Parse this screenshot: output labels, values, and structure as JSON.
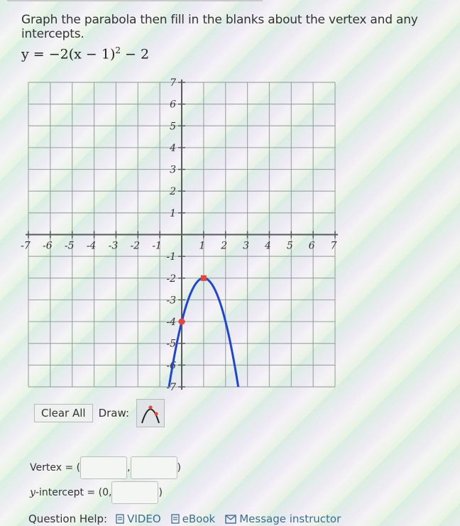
{
  "question": {
    "prompt": "Graph the parabola then fill in the blanks about the vertex and any intercepts.",
    "equation": {
      "prefix": "y = −2(x − 1)",
      "exponent": "2",
      "suffix": " − 2"
    }
  },
  "graph": {
    "x_range": [
      -7,
      7
    ],
    "y_range": [
      -7,
      7
    ],
    "x_tick_labels": [
      "-7",
      "-6",
      "-5",
      "-4",
      "-3",
      "-2",
      "-1",
      "1",
      "2",
      "3",
      "4",
      "5",
      "6",
      "7"
    ],
    "y_tick_labels": [
      "7",
      "6",
      "5",
      "4",
      "3",
      "2",
      "1",
      "-1",
      "-2",
      "-3",
      "-4",
      "-5",
      "-6",
      "-7"
    ],
    "curve": {
      "type": "parabola",
      "a": -2,
      "h": 1,
      "k": -2,
      "color": "#1f45d1"
    },
    "points": [
      {
        "name": "vertex-point",
        "x": 1,
        "y": -2,
        "shape": "square",
        "color": "#e8463a"
      },
      {
        "name": "second-point",
        "x": 0,
        "y": -4,
        "shape": "circle",
        "color": "#e8463a"
      }
    ],
    "grid_color": "#8c9a96",
    "axis_color": "#555a5a"
  },
  "controls": {
    "clear_all": "Clear All",
    "draw_label": "Draw:",
    "draw_tool": "parabola-tool"
  },
  "answers": {
    "vertex_label": "Vertex = (",
    "vertex_comma": ",",
    "vertex_close": ")",
    "vertex_x": "",
    "vertex_y": "",
    "yint_label_var": "y",
    "yint_label_rest": "-intercept = (0,",
    "yint_close": ")",
    "yint_value": ""
  },
  "help": {
    "label": "Question Help:",
    "links": [
      {
        "icon": "document-icon",
        "label": "VIDEO"
      },
      {
        "icon": "document-icon",
        "label": "eBook"
      },
      {
        "icon": "envelope-icon",
        "label": "Message instructor"
      }
    ]
  }
}
